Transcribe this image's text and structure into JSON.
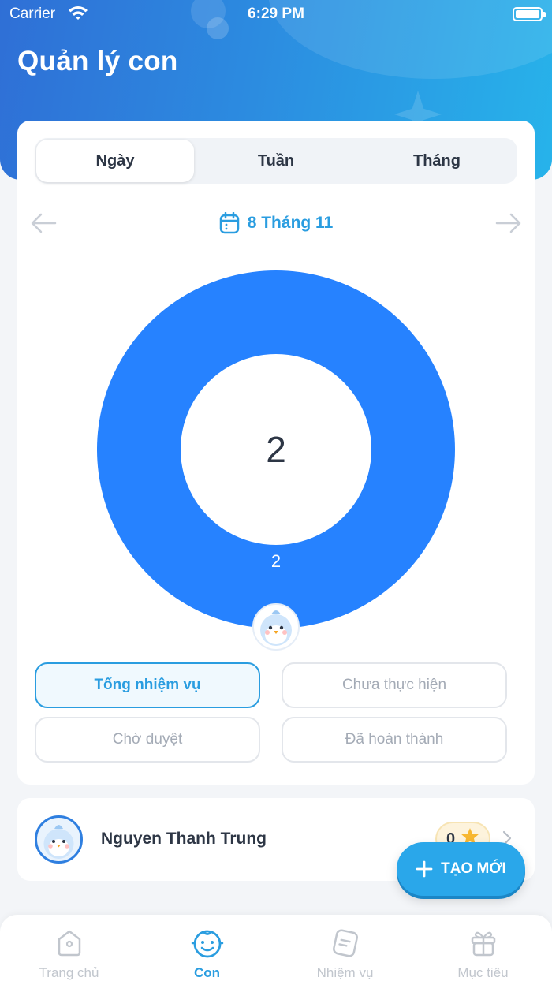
{
  "status_bar": {
    "carrier": "Carrier",
    "time": "6:29 PM"
  },
  "header": {
    "title": "Quản lý con"
  },
  "period_tabs": [
    {
      "label": "Ngày",
      "active": true
    },
    {
      "label": "Tuần",
      "active": false
    },
    {
      "label": "Tháng",
      "active": false
    }
  ],
  "date_nav": {
    "date_label": "8 Tháng 11"
  },
  "chart_data": {
    "type": "pie",
    "total": "2",
    "slices": [
      {
        "label": "2",
        "value": 2,
        "color": "#2682ff"
      }
    ]
  },
  "filters": [
    {
      "label": "Tổng nhiệm vụ",
      "active": true
    },
    {
      "label": "Chưa thực hiện",
      "active": false
    },
    {
      "label": "Chờ duyệt",
      "active": false
    },
    {
      "label": "Đã hoàn thành",
      "active": false
    }
  ],
  "child": {
    "name": "Nguyen Thanh Trung",
    "stars": "0",
    "star_icon": "star-icon"
  },
  "fab": {
    "label": "TẠO MỚI",
    "icon": "plus-icon"
  },
  "tabbar": [
    {
      "label": "Trang chủ",
      "icon": "home-icon",
      "active": false
    },
    {
      "label": "Con",
      "icon": "child-face-icon",
      "active": true
    },
    {
      "label": "Nhiệm vụ",
      "icon": "task-icon",
      "active": false
    },
    {
      "label": "Mục tiêu",
      "icon": "gift-icon",
      "active": false
    }
  ],
  "colors": {
    "primary": "#2a9de0",
    "donut": "#2682ff",
    "header_start": "#2f6fd6",
    "header_end": "#27b3ea"
  }
}
